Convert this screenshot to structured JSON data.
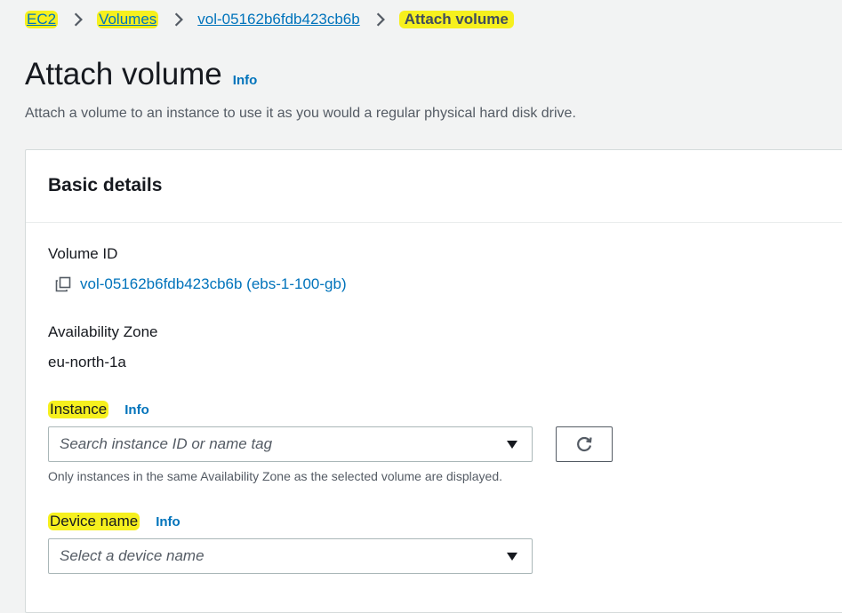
{
  "breadcrumb": {
    "items": [
      "EC2",
      "Volumes",
      "vol-05162b6fdb423cb6b"
    ],
    "current": "Attach volume"
  },
  "header": {
    "title": "Attach volume",
    "info_label": "Info",
    "description": "Attach a volume to an instance to use it as you would a regular physical hard disk drive."
  },
  "basic_details": {
    "title": "Basic details",
    "volume_id_label": "Volume ID",
    "volume_id_value": "vol-05162b6fdb423cb6b (ebs-1-100-gb)",
    "az_label": "Availability Zone",
    "az_value": "eu-north-1a",
    "instance_label": "Instance",
    "instance_info": "Info",
    "instance_placeholder": "Search instance ID or name tag",
    "instance_hint": "Only instances in the same Availability Zone as the selected volume are displayed.",
    "device_label": "Device name",
    "device_info": "Info",
    "device_placeholder": "Select a device name"
  },
  "icons": {
    "breadcrumb_separator": "chevron-right-icon",
    "copy": "copy-icon",
    "dropdown": "caret-down-icon",
    "refresh": "refresh-icon"
  },
  "colors": {
    "link": "#0073bb",
    "highlight": "#f6f01e",
    "page_background": "#f2f3f3",
    "panel_background": "#ffffff"
  }
}
